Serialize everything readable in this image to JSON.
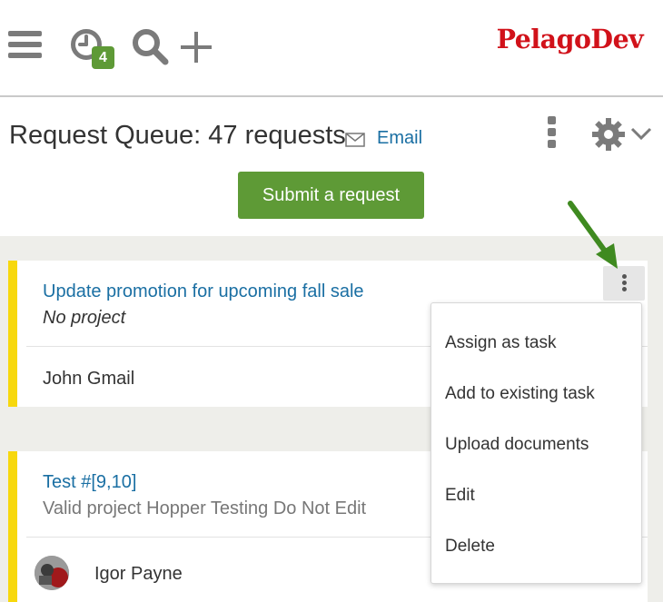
{
  "header": {
    "clock_badge_count": "4",
    "logo_text": "PelagoDev",
    "brand_color": "#d1121a",
    "icons": [
      "hamburger-icon",
      "clock-icon",
      "search-icon",
      "plus-icon"
    ]
  },
  "queue": {
    "title": "Request Queue: 47 requests",
    "email_label": "Email",
    "submit_label": "Submit a request",
    "accent_color": "#5e9a36"
  },
  "requests": [
    {
      "title": "Update promotion for upcoming fall sale",
      "project": "No project",
      "person": "John Gmail"
    },
    {
      "title": "Test #[9,10]",
      "project": "Valid project Hopper Testing Do Not Edit",
      "person": "Igor Payne"
    }
  ],
  "menu": {
    "items": [
      "Assign as task",
      "Add to existing task",
      "Upload documents",
      "Edit",
      "Delete"
    ]
  },
  "status_colors": {
    "card_stripe": "#f7d80d",
    "link": "#1a6fa3"
  }
}
